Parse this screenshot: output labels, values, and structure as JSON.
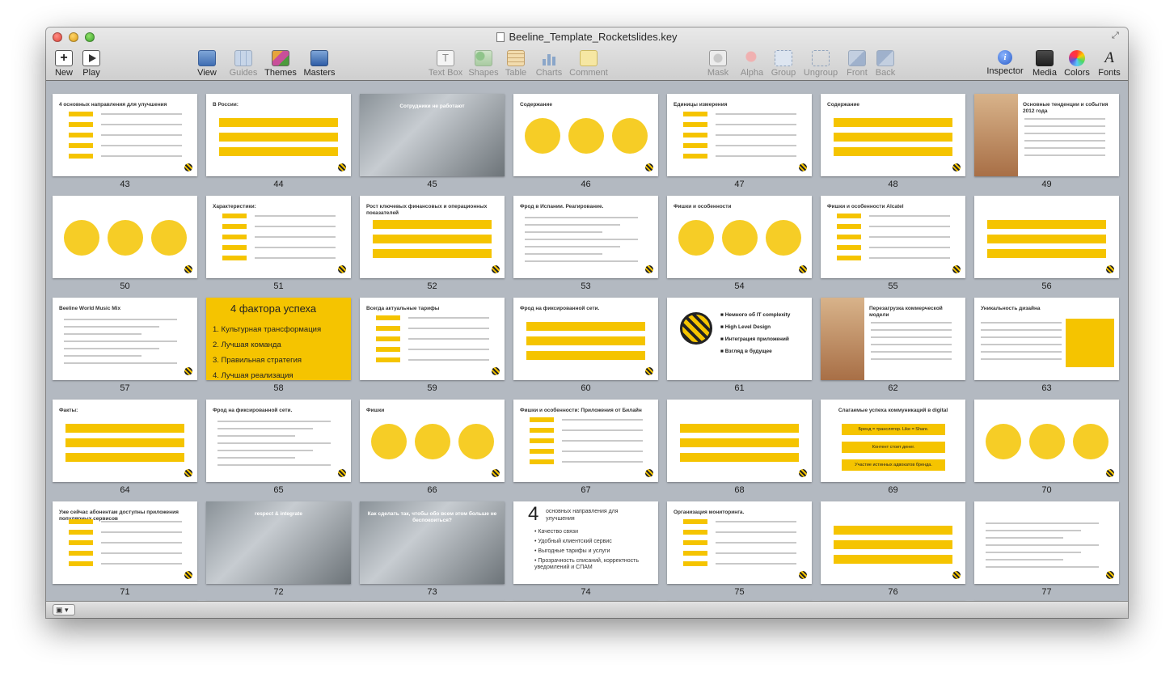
{
  "window": {
    "title": "Beeline_Template_Rocketslides.key"
  },
  "toolbar": {
    "left": [
      {
        "label": "New",
        "icon": "plus-icon"
      },
      {
        "label": "Play",
        "icon": "play-icon"
      }
    ],
    "middle": [
      {
        "label": "View",
        "icon": "view-icon",
        "enabled": true
      },
      {
        "label": "Guides",
        "icon": "guides-icon",
        "enabled": false
      },
      {
        "label": "Themes",
        "icon": "themes-icon",
        "enabled": true
      },
      {
        "label": "Masters",
        "icon": "masters-icon",
        "enabled": true
      }
    ],
    "insert": [
      {
        "label": "Text Box",
        "icon": "textbox-icon"
      },
      {
        "label": "Shapes",
        "icon": "shapes-icon"
      },
      {
        "label": "Table",
        "icon": "table-icon"
      },
      {
        "label": "Charts",
        "icon": "charts-icon"
      },
      {
        "label": "Comment",
        "icon": "comment-icon"
      }
    ],
    "arrange": [
      {
        "label": "Mask",
        "icon": "mask-icon"
      },
      {
        "label": "Alpha",
        "icon": "alpha-icon"
      },
      {
        "label": "Group",
        "icon": "group-icon"
      },
      {
        "label": "Ungroup",
        "icon": "ungroup-icon"
      },
      {
        "label": "Front",
        "icon": "front-icon"
      },
      {
        "label": "Back",
        "icon": "back-icon"
      }
    ],
    "right": [
      {
        "label": "Inspector",
        "icon": "inspector-icon"
      },
      {
        "label": "Media",
        "icon": "media-icon"
      },
      {
        "label": "Colors",
        "icon": "colors-icon"
      },
      {
        "label": "Fonts",
        "icon": "fonts-icon"
      }
    ]
  },
  "slides": [
    {
      "n": "43",
      "title": "4 основных направления для улучшения"
    },
    {
      "n": "44",
      "title": "В России:"
    },
    {
      "n": "45",
      "title": "Сотрудники не работают"
    },
    {
      "n": "46",
      "title": "Содержание"
    },
    {
      "n": "47",
      "title": "Единицы измерения"
    },
    {
      "n": "48",
      "title": "Содержание"
    },
    {
      "n": "49",
      "title": "Основные тенденции и события 2012 года"
    },
    {
      "n": "50",
      "title": ""
    },
    {
      "n": "51",
      "title": "Характеристики:"
    },
    {
      "n": "52",
      "title": "Рост ключевых финансовых и операционных показателей"
    },
    {
      "n": "53",
      "title": "Фрод в Испании. Реагирование."
    },
    {
      "n": "54",
      "title": "Фишки и особенности"
    },
    {
      "n": "55",
      "title": "Фишки и особенности Alcatel"
    },
    {
      "n": "56",
      "title": ""
    },
    {
      "n": "57",
      "title": "Beeline World Music Mix"
    },
    {
      "n": "58",
      "title": "4 фактора успеха"
    },
    {
      "n": "59",
      "title": "Всегда актуальные тарифы"
    },
    {
      "n": "60",
      "title": "Фрод на фиксированной сети."
    },
    {
      "n": "61",
      "title": "Немного об IT complexity"
    },
    {
      "n": "62",
      "title": "Перезагрузка коммерческой модели"
    },
    {
      "n": "63",
      "title": "Уникальность дизайна"
    },
    {
      "n": "64",
      "title": "Факты:"
    },
    {
      "n": "65",
      "title": "Фрод на фиксированной сети."
    },
    {
      "n": "66",
      "title": "Фишки"
    },
    {
      "n": "67",
      "title": "Фишки и особенности: Приложения от Билайн"
    },
    {
      "n": "68",
      "title": ""
    },
    {
      "n": "69",
      "title": "Слагаемые успеха коммуникаций в digital"
    },
    {
      "n": "70",
      "title": ""
    },
    {
      "n": "71",
      "title": "Уже сейчас абонентам доступны приложения популярных сервисов"
    },
    {
      "n": "72",
      "title": "respect & integrate"
    },
    {
      "n": "73",
      "title": "Как сделать так, чтобы обо всем этом больше не беспокоиться?"
    },
    {
      "n": "74",
      "title": "4 основных направления для улучшения"
    },
    {
      "n": "75",
      "title": "Организация мониторинга."
    },
    {
      "n": "76",
      "title": ""
    },
    {
      "n": "77",
      "title": ""
    }
  ],
  "slide58": {
    "heading": "4 фактора успеха",
    "items": [
      "1. Культурная трансформация",
      "2. Лучшая команда",
      "3. Правильная стратегия",
      "4. Лучшая реализация"
    ]
  },
  "slide74": {
    "heading": "основных направления для улучшения",
    "number": "4",
    "items": [
      "Качество связи",
      "Удобный клиентский сервис",
      "Выгодные тарифы и услуги",
      "Прозрачность списаний, корректность уведомлений и СПАМ"
    ]
  },
  "slide61": {
    "items": [
      "Немного об IT complexity",
      "High Level Design",
      "Интеграция приложений",
      "Взгляд в будущее"
    ]
  },
  "slide69": {
    "items": [
      "Бренд = транслятор. Like = Share.",
      "Контент стоит денег.",
      "Участие истинных адвокатов бренда."
    ]
  },
  "colors": {
    "accent": "#f5c400",
    "background": "#b3b9c1"
  }
}
